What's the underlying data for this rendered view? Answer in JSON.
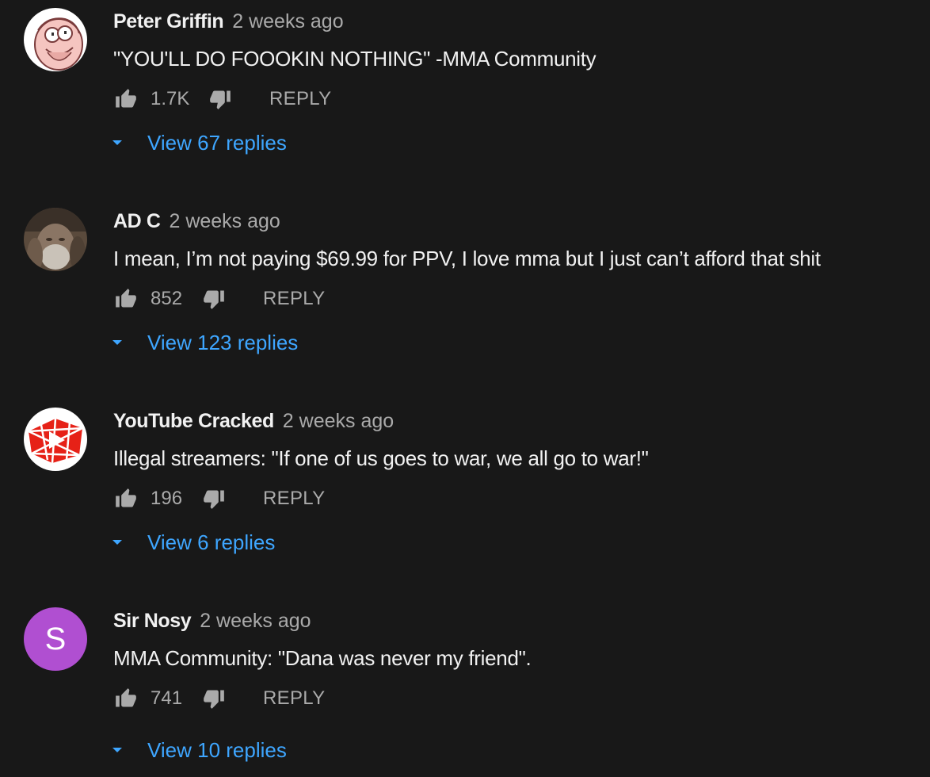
{
  "comments": [
    {
      "author": "Peter Griffin",
      "time": "2 weeks ago",
      "text": "\"YOU'LL DO FOOOKIN NOTHING\" -MMA Community",
      "likes": "1.7K",
      "reply_label": "REPLY",
      "view_replies": "View 67 replies",
      "avatar": "peter-griffin-avatar"
    },
    {
      "author": "AD C",
      "time": "2 weeks ago",
      "text": "I mean, I’m not paying $69.99 for PPV, I love mma but I just can’t afford that shit",
      "likes": "852",
      "reply_label": "REPLY",
      "view_replies": "View 123 replies",
      "avatar": "photo-avatar"
    },
    {
      "author": "YouTube Cracked",
      "time": "2 weeks ago",
      "text": "Illegal streamers: \"If one of us goes to war, we all go to war!\"",
      "likes": "196",
      "reply_label": "REPLY",
      "view_replies": "View 6 replies",
      "avatar": "cracked-youtube-logo-avatar"
    },
    {
      "author": "Sir Nosy",
      "time": "2 weeks ago",
      "text": "MMA Community: \"Dana was never my friend\".",
      "likes": "741",
      "reply_label": "REPLY",
      "view_replies": "View 10 replies",
      "avatar": "letter-avatar",
      "avatar_letter": "S",
      "avatar_color": "#b04fd1"
    }
  ],
  "colors": {
    "background": "#181818",
    "text": "#f1f1f1",
    "secondary": "#aaaaaa",
    "link": "#3ea6ff"
  },
  "icons": {
    "like": "thumbs-up-icon",
    "dislike": "thumbs-down-icon",
    "expand": "caret-down-icon"
  }
}
